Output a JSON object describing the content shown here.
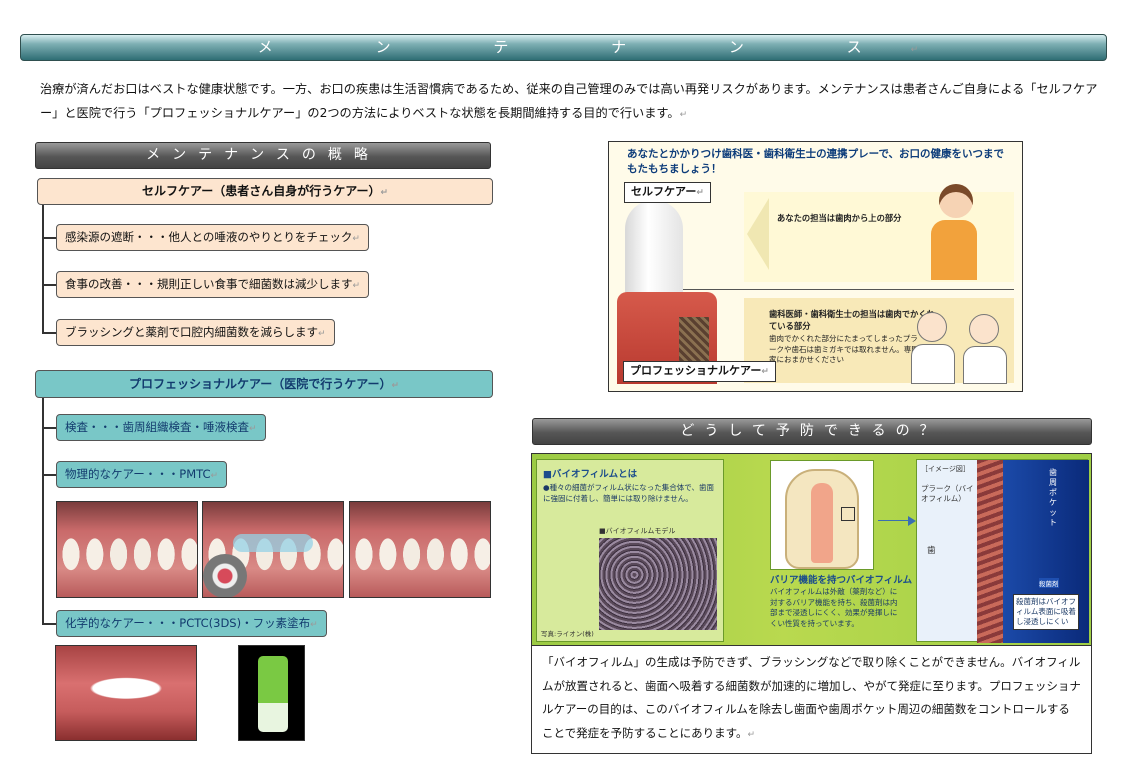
{
  "banner": "メ ン テ ナ ン ス",
  "intro": "治療が済んだお口はベストな健康状態です。一方、お口の疾患は生活習慣病であるため、従来の自己管理のみでは高い再発リスクがあります。メンテナンスは患者さんご自身による「セルフケアー」と医院で行う「プロフェッショナルケアー」の2つの方法によりベストな状態を長期間維持する目的で行います。",
  "overview": {
    "header": "メンテナンスの概略",
    "self_care": {
      "title": "セルフケアー（患者さん自身が行うケアー）",
      "items": [
        "感染源の遮断・・・他人との唾液のやりとりをチェック",
        "食事の改善・・・規則正しい食事で細菌数は減少します",
        "ブラッシングと薬剤で口腔内細菌数を減らします"
      ]
    },
    "pro_care": {
      "title": "プロフェッショナルケアー（医院で行うケアー）",
      "items": [
        "検査・・・歯周組織検査・唾液検査",
        "物理的なケアー・・・PMTC",
        "化学的なケアー・・・PCTC(3DS)・フッ素塗布"
      ]
    }
  },
  "diagram": {
    "title": "あなたとかかりつけ歯科医・歯科衛生士の連携プレーで、お口の健康をいつまでもたもちましょう！",
    "self_label": "セルフケアー",
    "self_note": "あなたの担当は歯肉から上の部分",
    "pro_label": "プロフェッショナルケアー",
    "pro_note_title": "歯科医師・歯科衛生士の担当は歯肉でかくれている部分",
    "pro_note_body": "歯肉でかくれた部分にたまってしまったプラークや歯石は歯ミガキでは取れません。専門家におまかせください"
  },
  "prevent": {
    "header": "どうして予防できるの？",
    "biofilm": {
      "box_title": "■バイオフィルムとは",
      "box_body": "●種々の細菌がフィルム状になった集合体で、歯面に強固に付着し、簡単には取り除けません。",
      "model_label": "■バイオフィルムモデル",
      "photo_credit": "写真:ライオン(株)",
      "barrier_title": "バリア機能を持つバイオフィルム",
      "barrier_body": "バイオフィルムは外敵（薬剤など）に対するバリア機能を持ち、殺菌剤は内部まで浸透しにくく、効果が発揮しにくい性質を持っています。",
      "image_tag": "［イメージ図］",
      "plaque_label": "プラーク（バイオフィルム）",
      "tooth_label": "歯",
      "pocket_label": "歯周ポケット",
      "germicide_label": "殺菌剤",
      "germicide_note": "殺菌剤はバイオフィルム表面に吸着し浸透しにくい"
    },
    "text": "「バイオフィルム」の生成は予防できず、ブラッシングなどで取り除くことができません。バイオフィルムが放置されると、歯面へ吸着する細菌数が加速的に増加し、やがて発症に至ります。プロフェッショナルケアーの目的は、このバイオフィルムを除去し歯面や歯周ポケット周辺の細菌数をコントロールすることで発症を予防することにあります。"
  }
}
